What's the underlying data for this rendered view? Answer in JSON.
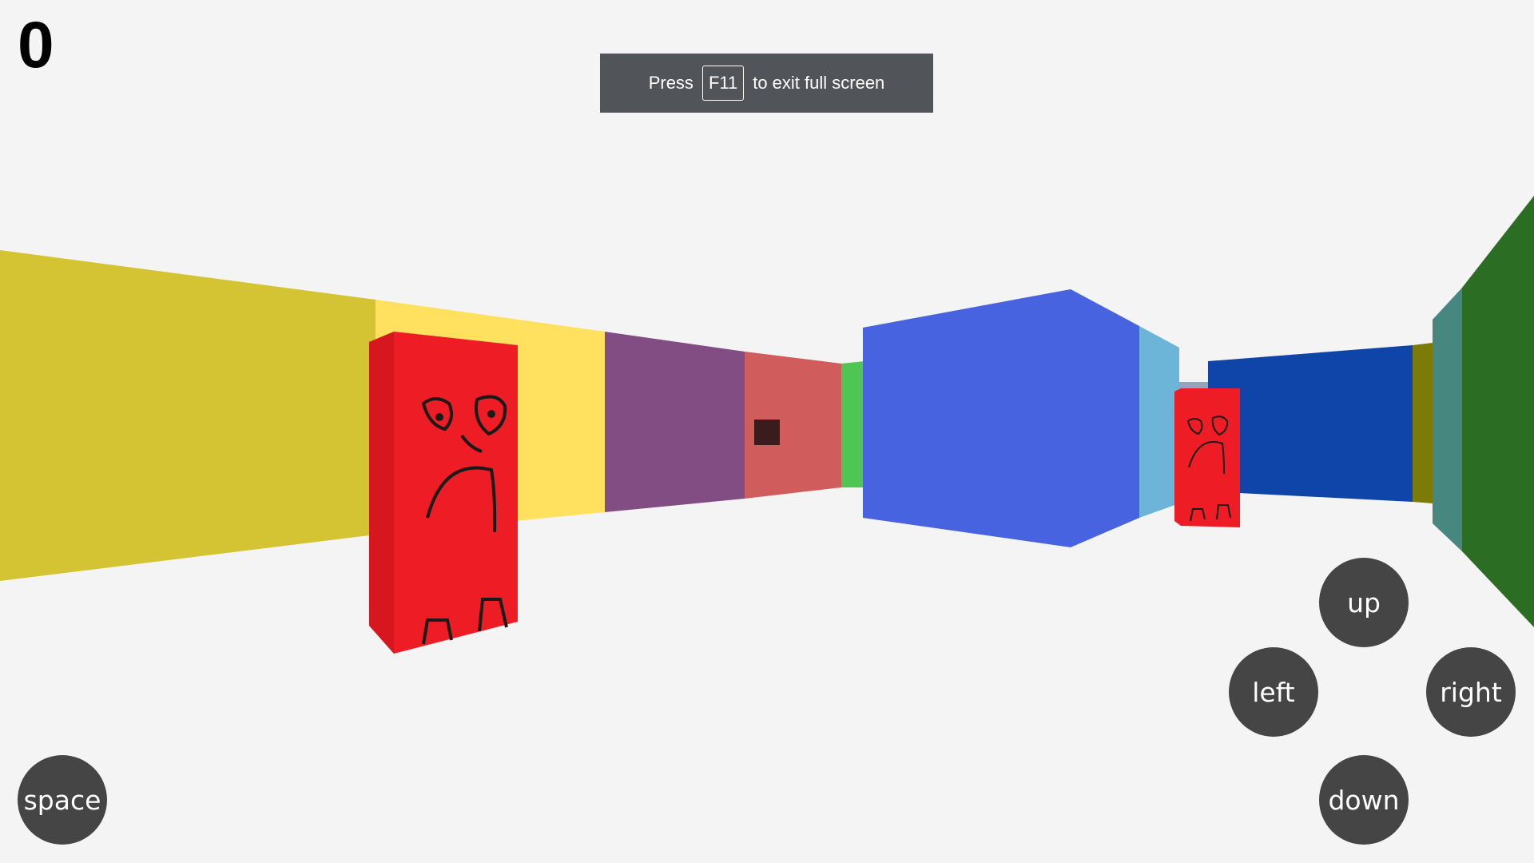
{
  "hud": {
    "score": "0"
  },
  "fullscreen_notice": {
    "prefix": "Press",
    "key": "F11",
    "suffix": "to exit full screen"
  },
  "controls": {
    "up": "up",
    "left": "left",
    "right": "right",
    "down": "down",
    "space": "space"
  },
  "scene_colors": {
    "background": "#f4f4f4",
    "wall_olive_yellow": "#d4c333",
    "wall_yellow": "#ffe05f",
    "wall_purple": "#824d82",
    "wall_salmon": "#d05c5c",
    "wall_green": "#4fc653",
    "wall_blue": "#4763e0",
    "wall_light_blue": "#6db5d8",
    "wall_navy": "#0f45a8",
    "wall_olive": "#7c7a09",
    "wall_teal": "#46877f",
    "wall_dark_green": "#2c6d24",
    "enemy_red": "#ee1c25",
    "pickup_dark": "#3a1c1c"
  }
}
